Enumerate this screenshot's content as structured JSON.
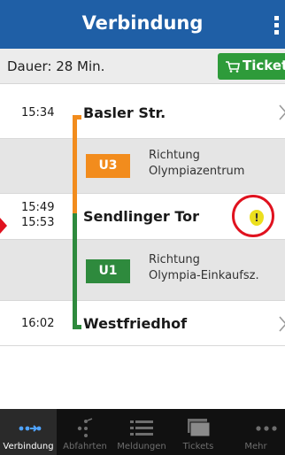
{
  "header": {
    "title": "Verbindung",
    "menu_icon": "more-vertical-icon"
  },
  "summary": {
    "duration": "Dauer: 28 Min.",
    "ticket_label": "Ticket",
    "ticket_icon": "cart-icon"
  },
  "journey": {
    "stops": [
      {
        "times": [
          "15:34"
        ],
        "name": "Basler Str."
      },
      {
        "times": [
          "15:49",
          "15:53"
        ],
        "name": "Sendlinger Tor",
        "alert_icon": "warning-icon",
        "alert_mark": "!"
      },
      {
        "times": [
          "16:02"
        ],
        "name": "Westfriedhof"
      }
    ],
    "segments": [
      {
        "line": "U3",
        "direction_label": "Richtung",
        "direction": "Olympiazentrum",
        "color": "#f28c1d"
      },
      {
        "line": "U1",
        "direction_label": "Richtung",
        "direction": "Olympia-Einkaufsz.",
        "color": "#2e8a3d"
      }
    ]
  },
  "tabs": [
    {
      "label": "Verbindung",
      "icon": "route-icon",
      "active": true
    },
    {
      "label": "Abfahrten",
      "icon": "departures-icon"
    },
    {
      "label": "Meldungen",
      "icon": "list-icon"
    },
    {
      "label": "Tickets",
      "icon": "tickets-icon"
    },
    {
      "label": "Mehr",
      "icon": "more-icon"
    }
  ],
  "colors": {
    "header": "#1f5fa6",
    "ticket": "#2e9b3a",
    "u3": "#f28c1d",
    "u1": "#2e8a3d",
    "highlight": "#e0121f",
    "alert": "#ecdf1e"
  }
}
